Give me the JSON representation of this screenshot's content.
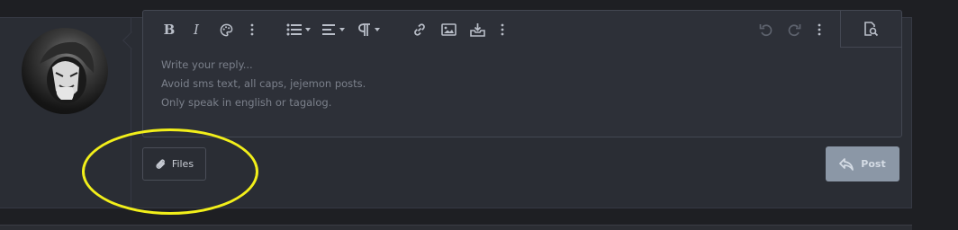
{
  "editor": {
    "placeholder_lines": [
      "Write your reply...",
      "Avoid sms text, all caps, jejemon posts.",
      "Only speak in english or tagalog."
    ],
    "toolbar": {
      "bold": "B",
      "italic": "I",
      "text_color": "palette-icon",
      "more_text": "ellipsis-vertical-icon",
      "list": "list-icon",
      "align": "align-icon",
      "paragraph": "paragraph-icon",
      "link": "link-icon",
      "image": "image-icon",
      "insert": "inbox-insert-icon",
      "more_insert": "ellipsis-vertical-icon",
      "undo": "undo-icon",
      "redo": "redo-icon",
      "more_options": "ellipsis-vertical-icon",
      "preview": "preview-icon"
    }
  },
  "actions": {
    "files_label": "Files",
    "post_label": "Post"
  },
  "annotation": {
    "color": "#f2ef1a"
  }
}
